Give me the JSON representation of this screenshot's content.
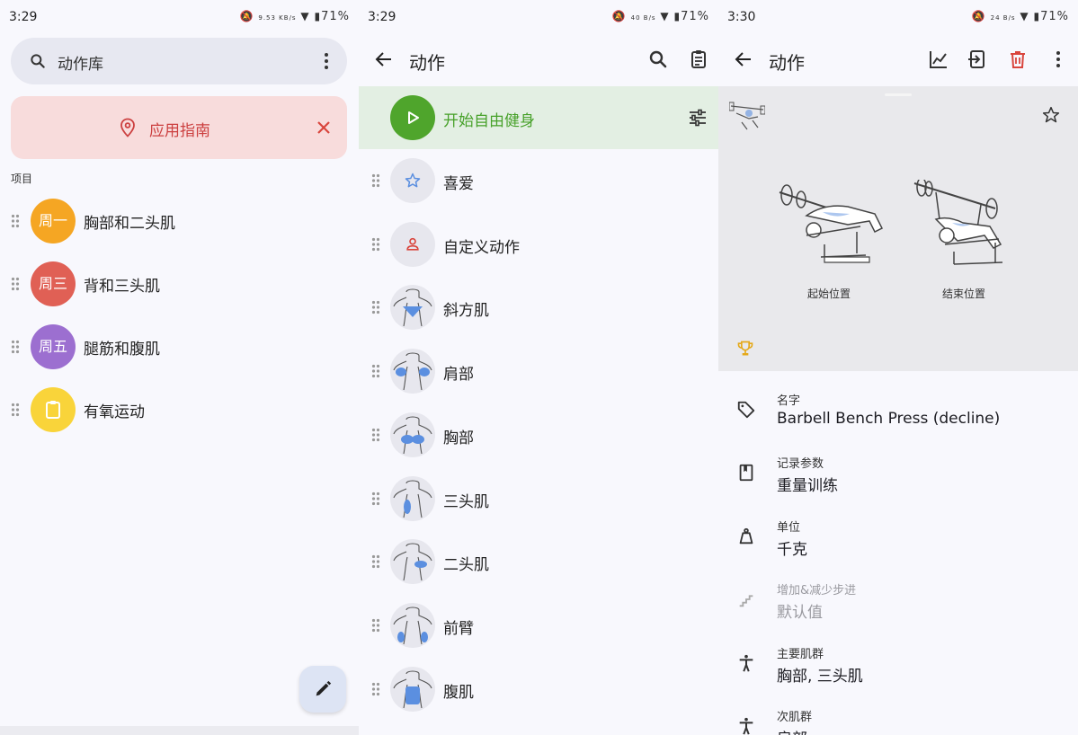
{
  "panel1": {
    "status": {
      "time": "3:29",
      "speed": "9.53 KB/s",
      "battery": "71%"
    },
    "search": {
      "text": "动作库"
    },
    "guide": {
      "label": "应用指南"
    },
    "section_label": "项目",
    "routines": [
      {
        "avatar": "周一",
        "label": "胸部和二头肌",
        "color": "#f5a623"
      },
      {
        "avatar": "周三",
        "label": "背和三头肌",
        "color": "#e06055"
      },
      {
        "avatar": "周五",
        "label": "腿筋和腹肌",
        "color": "#9c6fd0"
      },
      {
        "avatar": "",
        "label": "有氧运动",
        "color": "#f9d43a",
        "icon": "clipboard-icon"
      }
    ]
  },
  "panel2": {
    "status": {
      "time": "3:29",
      "speed": "40 B/s",
      "battery": "71%"
    },
    "title": "动作",
    "free_workout": "开始自由健身",
    "categories": [
      {
        "label": "喜爱",
        "icon": "star-icon"
      },
      {
        "label": "自定义动作",
        "icon": "person-icon"
      },
      {
        "label": "斜方肌",
        "icon": "trapezius-muscle-icon"
      },
      {
        "label": "肩部",
        "icon": "shoulders-muscle-icon"
      },
      {
        "label": "胸部",
        "icon": "chest-muscle-icon"
      },
      {
        "label": "三头肌",
        "icon": "triceps-muscle-icon"
      },
      {
        "label": "二头肌",
        "icon": "biceps-muscle-icon"
      },
      {
        "label": "前臂",
        "icon": "forearms-muscle-icon"
      },
      {
        "label": "腹肌",
        "icon": "abs-muscle-icon"
      }
    ]
  },
  "panel3": {
    "status": {
      "time": "3:30",
      "speed": "24 B/s",
      "battery": "71%"
    },
    "title": "动作",
    "captions": {
      "start": "起始位置",
      "end": "结束位置"
    },
    "properties": [
      {
        "label": "名字",
        "value": "Barbell Bench Press (decline)",
        "icon": "tag-icon",
        "disabled": false
      },
      {
        "label": "记录参数",
        "value": "重量训练",
        "icon": "bookmark-icon",
        "disabled": false
      },
      {
        "label": "单位",
        "value": "千克",
        "icon": "weight-icon",
        "disabled": false
      },
      {
        "label": "增加&减少步进",
        "value": "默认值",
        "icon": "stairs-icon",
        "disabled": true
      },
      {
        "label": "主要肌群",
        "value": "胸部, 三头肌",
        "icon": "body-icon",
        "disabled": false
      },
      {
        "label": "次肌群",
        "value": "肩部",
        "icon": "body-icon",
        "disabled": false
      }
    ]
  },
  "colors": {
    "accent_green": "#4fa52c",
    "danger_red": "#d9453d",
    "guide_bg": "#f8dcdc",
    "muscle_blue": "#5b8fe0"
  }
}
